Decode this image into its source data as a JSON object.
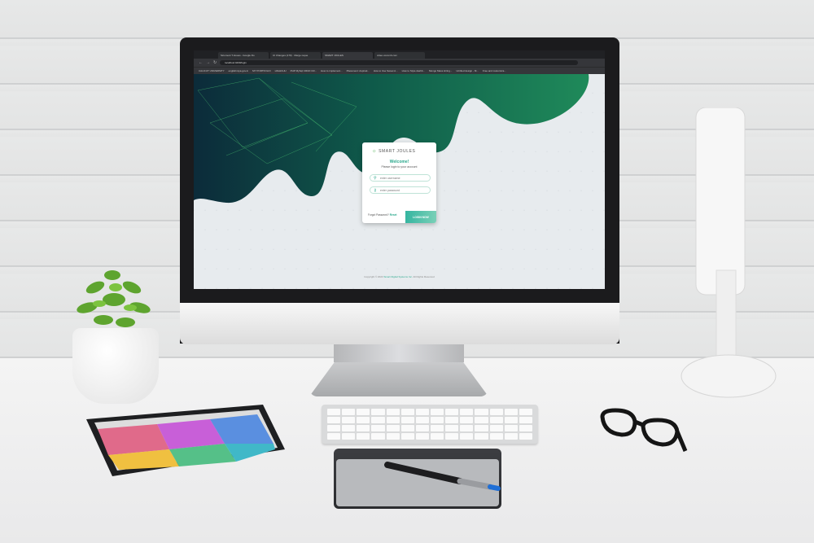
{
  "browser": {
    "tabs": [
      {
        "label": "Sicoment T-Issues - Google Do"
      },
      {
        "label": "UI Changes (179) · Merge reque"
      },
      {
        "label": "SMART JOULES"
      },
      {
        "label": "video.vocomb.com"
      }
    ],
    "url": "localhost:4200/login",
    "bookmarks": [
      "CALICUT UNIVERSITY",
      "englishmiya.gov.in",
      "MY PORTFOLIO",
      "HIGHCHU",
      "PHP MySql CRUD CR...",
      "How to implement...",
      "Placement: Aspirati...",
      "How to Use Sweet A...",
      "How to Style dashb...",
      "Mongo Mass Hiring...",
      "Untitled design - M...",
      "Free and customiza..."
    ]
  },
  "login": {
    "logo_text": "SMART JOULES",
    "welcome": "Welcome!",
    "subtitle": "Please login to your account",
    "username_placeholder": "enter username",
    "password_placeholder": "enter password",
    "forgot_label": "Forgot Password?",
    "reset_label": "Reset",
    "login_button": "LOGIN NOW"
  },
  "footer": {
    "prefix": "Copyright © 2023",
    "brand": "Smart Digital Systems Inc.",
    "suffix": "All Rights Reserved"
  },
  "colors": {
    "accent": "#2aa88c",
    "wave_dark": "#0d3b4a",
    "wave_green": "#1f7a4a"
  }
}
